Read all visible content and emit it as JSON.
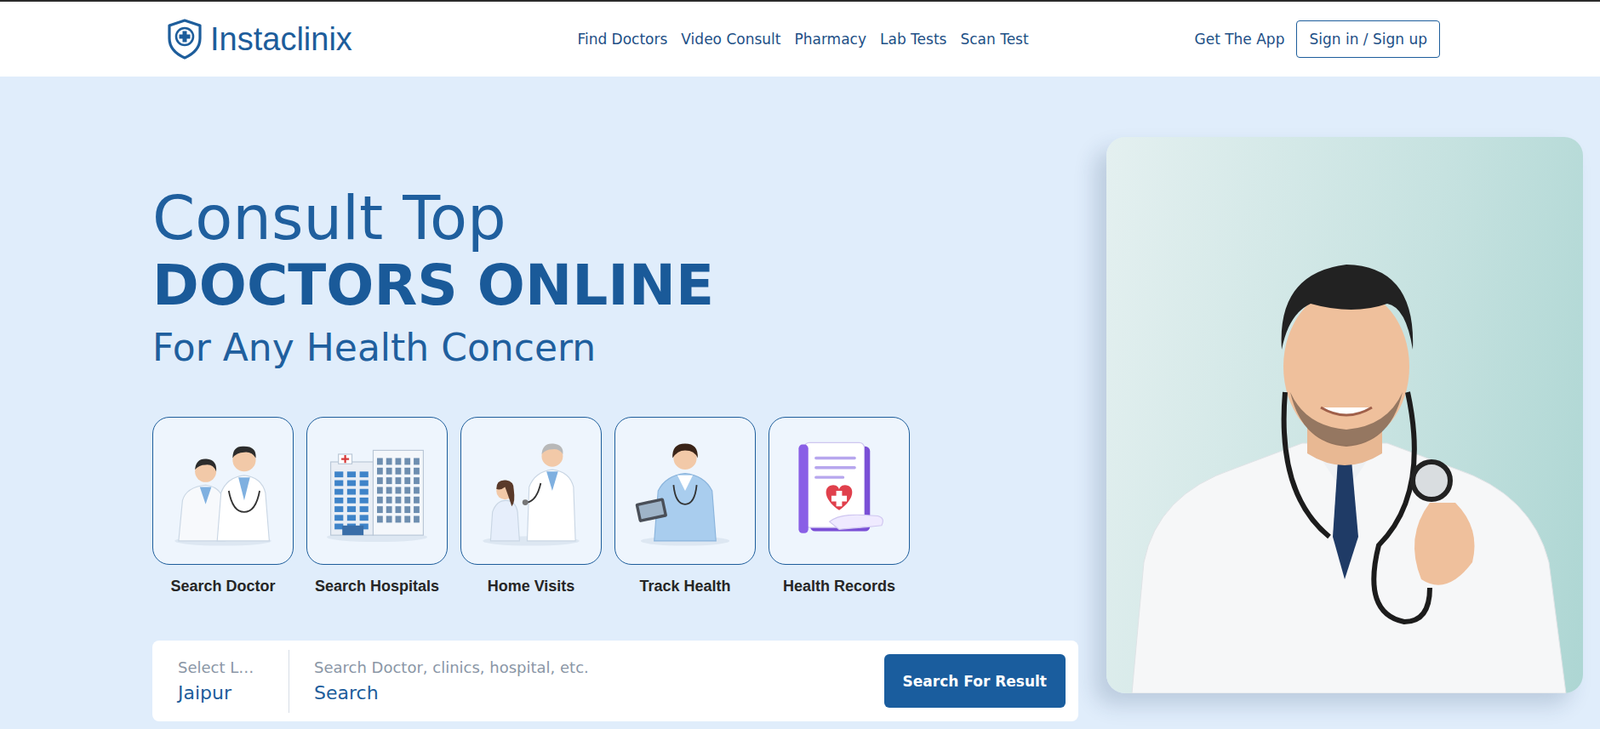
{
  "logo": {
    "text": "Instaclinix"
  },
  "nav": [
    {
      "label": "Find Doctors"
    },
    {
      "label": "Video Consult"
    },
    {
      "label": "Pharmacy"
    },
    {
      "label": "Lab Tests"
    },
    {
      "label": "Scan Test"
    }
  ],
  "header_actions": {
    "app_link": "Get The App",
    "sign_in": "Sign in / Sign up"
  },
  "hero": {
    "title_line1": "Consult Top",
    "title_line2": "DOCTORS ONLINE",
    "subtitle": "For Any Health Concern"
  },
  "services": [
    {
      "label": "Search Doctor",
      "kind": "doctors"
    },
    {
      "label": "Search Hospitals",
      "kind": "hospital"
    },
    {
      "label": "Home Visits",
      "kind": "visit"
    },
    {
      "label": "Track Health",
      "kind": "nurse"
    },
    {
      "label": "Health Records",
      "kind": "records"
    }
  ],
  "search": {
    "location_label": "Select L…",
    "location_value": "Jaipur",
    "query_placeholder": "Search Doctor, clinics, hospital, etc.",
    "query_value": "Search",
    "button": "Search For Result"
  }
}
